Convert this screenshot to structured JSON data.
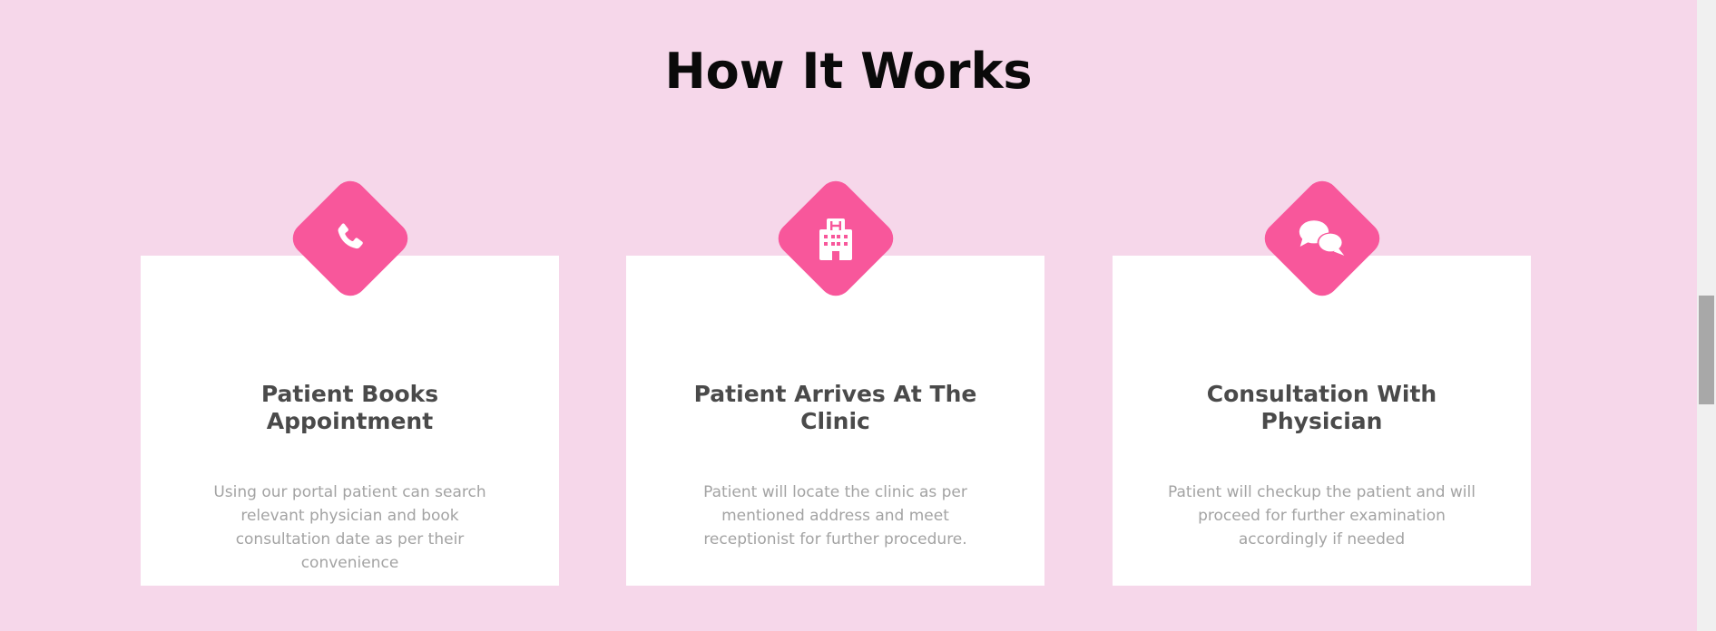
{
  "section": {
    "title": "How It Works"
  },
  "steps": [
    {
      "icon": "phone-icon",
      "title": "Patient Books Appointment",
      "description": "Using our portal patient can search relevant physician and book consultation date as per their convenience"
    },
    {
      "icon": "hospital-icon",
      "title": "Patient Arrives At The Clinic",
      "description": "Patient will locate the clinic as per mentioned address and meet receptionist for further procedure."
    },
    {
      "icon": "chat-bubbles-icon",
      "title": "Consultation With Physician",
      "description": "Patient will checkup the patient and will proceed for further examination accordingly if needed"
    }
  ],
  "colors": {
    "background": "#f6d7ea",
    "accent": "#f8579b",
    "card": "#ffffff",
    "title_text": "#4a4a4a",
    "body_text": "#a3a3a3"
  }
}
